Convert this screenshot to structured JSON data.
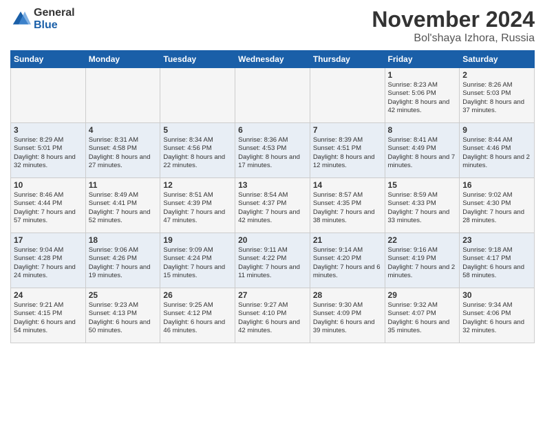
{
  "logo": {
    "general": "General",
    "blue": "Blue"
  },
  "header": {
    "month": "November 2024",
    "location": "Bol'shaya Izhora, Russia"
  },
  "weekdays": [
    "Sunday",
    "Monday",
    "Tuesday",
    "Wednesday",
    "Thursday",
    "Friday",
    "Saturday"
  ],
  "weeks": [
    [
      {
        "day": "",
        "text": ""
      },
      {
        "day": "",
        "text": ""
      },
      {
        "day": "",
        "text": ""
      },
      {
        "day": "",
        "text": ""
      },
      {
        "day": "",
        "text": ""
      },
      {
        "day": "1",
        "text": "Sunrise: 8:23 AM\nSunset: 5:06 PM\nDaylight: 8 hours and 42 minutes."
      },
      {
        "day": "2",
        "text": "Sunrise: 8:26 AM\nSunset: 5:03 PM\nDaylight: 8 hours and 37 minutes."
      }
    ],
    [
      {
        "day": "3",
        "text": "Sunrise: 8:29 AM\nSunset: 5:01 PM\nDaylight: 8 hours and 32 minutes."
      },
      {
        "day": "4",
        "text": "Sunrise: 8:31 AM\nSunset: 4:58 PM\nDaylight: 8 hours and 27 minutes."
      },
      {
        "day": "5",
        "text": "Sunrise: 8:34 AM\nSunset: 4:56 PM\nDaylight: 8 hours and 22 minutes."
      },
      {
        "day": "6",
        "text": "Sunrise: 8:36 AM\nSunset: 4:53 PM\nDaylight: 8 hours and 17 minutes."
      },
      {
        "day": "7",
        "text": "Sunrise: 8:39 AM\nSunset: 4:51 PM\nDaylight: 8 hours and 12 minutes."
      },
      {
        "day": "8",
        "text": "Sunrise: 8:41 AM\nSunset: 4:49 PM\nDaylight: 8 hours and 7 minutes."
      },
      {
        "day": "9",
        "text": "Sunrise: 8:44 AM\nSunset: 4:46 PM\nDaylight: 8 hours and 2 minutes."
      }
    ],
    [
      {
        "day": "10",
        "text": "Sunrise: 8:46 AM\nSunset: 4:44 PM\nDaylight: 7 hours and 57 minutes."
      },
      {
        "day": "11",
        "text": "Sunrise: 8:49 AM\nSunset: 4:41 PM\nDaylight: 7 hours and 52 minutes."
      },
      {
        "day": "12",
        "text": "Sunrise: 8:51 AM\nSunset: 4:39 PM\nDaylight: 7 hours and 47 minutes."
      },
      {
        "day": "13",
        "text": "Sunrise: 8:54 AM\nSunset: 4:37 PM\nDaylight: 7 hours and 42 minutes."
      },
      {
        "day": "14",
        "text": "Sunrise: 8:57 AM\nSunset: 4:35 PM\nDaylight: 7 hours and 38 minutes."
      },
      {
        "day": "15",
        "text": "Sunrise: 8:59 AM\nSunset: 4:33 PM\nDaylight: 7 hours and 33 minutes."
      },
      {
        "day": "16",
        "text": "Sunrise: 9:02 AM\nSunset: 4:30 PM\nDaylight: 7 hours and 28 minutes."
      }
    ],
    [
      {
        "day": "17",
        "text": "Sunrise: 9:04 AM\nSunset: 4:28 PM\nDaylight: 7 hours and 24 minutes."
      },
      {
        "day": "18",
        "text": "Sunrise: 9:06 AM\nSunset: 4:26 PM\nDaylight: 7 hours and 19 minutes."
      },
      {
        "day": "19",
        "text": "Sunrise: 9:09 AM\nSunset: 4:24 PM\nDaylight: 7 hours and 15 minutes."
      },
      {
        "day": "20",
        "text": "Sunrise: 9:11 AM\nSunset: 4:22 PM\nDaylight: 7 hours and 11 minutes."
      },
      {
        "day": "21",
        "text": "Sunrise: 9:14 AM\nSunset: 4:20 PM\nDaylight: 7 hours and 6 minutes."
      },
      {
        "day": "22",
        "text": "Sunrise: 9:16 AM\nSunset: 4:19 PM\nDaylight: 7 hours and 2 minutes."
      },
      {
        "day": "23",
        "text": "Sunrise: 9:18 AM\nSunset: 4:17 PM\nDaylight: 6 hours and 58 minutes."
      }
    ],
    [
      {
        "day": "24",
        "text": "Sunrise: 9:21 AM\nSunset: 4:15 PM\nDaylight: 6 hours and 54 minutes."
      },
      {
        "day": "25",
        "text": "Sunrise: 9:23 AM\nSunset: 4:13 PM\nDaylight: 6 hours and 50 minutes."
      },
      {
        "day": "26",
        "text": "Sunrise: 9:25 AM\nSunset: 4:12 PM\nDaylight: 6 hours and 46 minutes."
      },
      {
        "day": "27",
        "text": "Sunrise: 9:27 AM\nSunset: 4:10 PM\nDaylight: 6 hours and 42 minutes."
      },
      {
        "day": "28",
        "text": "Sunrise: 9:30 AM\nSunset: 4:09 PM\nDaylight: 6 hours and 39 minutes."
      },
      {
        "day": "29",
        "text": "Sunrise: 9:32 AM\nSunset: 4:07 PM\nDaylight: 6 hours and 35 minutes."
      },
      {
        "day": "30",
        "text": "Sunrise: 9:34 AM\nSunset: 4:06 PM\nDaylight: 6 hours and 32 minutes."
      }
    ]
  ]
}
